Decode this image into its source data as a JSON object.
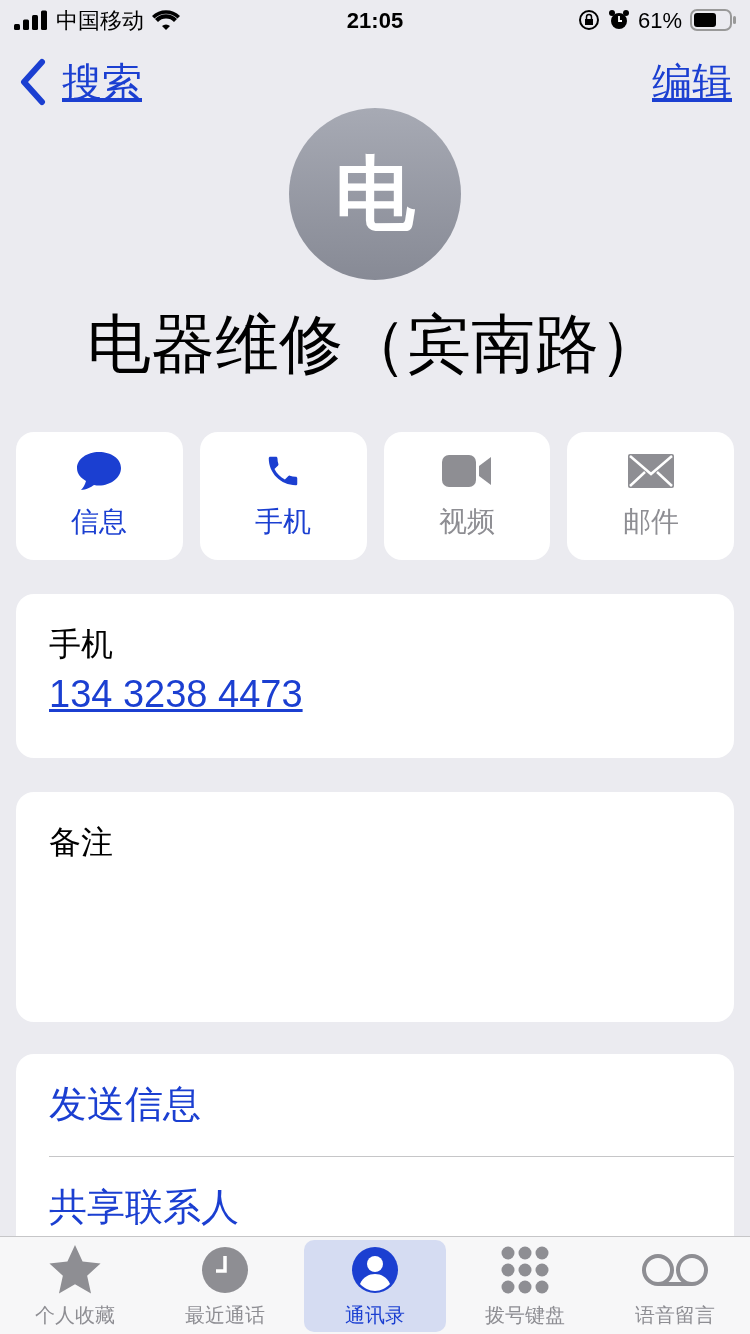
{
  "status_bar": {
    "carrier": "中国移动",
    "time": "21:05",
    "battery": "61%"
  },
  "nav": {
    "back": "搜索",
    "edit": "编辑"
  },
  "contact": {
    "initial": "电",
    "name": "电器维修（宾南路）"
  },
  "actions": [
    {
      "kind": "message",
      "label": "信息",
      "disabled": false
    },
    {
      "kind": "phone",
      "label": "手机",
      "disabled": false
    },
    {
      "kind": "video",
      "label": "视频",
      "disabled": true
    },
    {
      "kind": "mail",
      "label": "邮件",
      "disabled": true
    }
  ],
  "phone": {
    "label": "手机",
    "number": "134 3238 4473"
  },
  "notes": {
    "label": "备注"
  },
  "links": [
    "发送信息",
    "共享联系人"
  ],
  "tabs": [
    {
      "kind": "favorites",
      "label": "个人收藏",
      "selected": false
    },
    {
      "kind": "recents",
      "label": "最近通话",
      "selected": false
    },
    {
      "kind": "contacts",
      "label": "通讯录",
      "selected": true
    },
    {
      "kind": "keypad",
      "label": "拨号键盘",
      "selected": false
    },
    {
      "kind": "voicemail",
      "label": "语音留言",
      "selected": false
    }
  ]
}
